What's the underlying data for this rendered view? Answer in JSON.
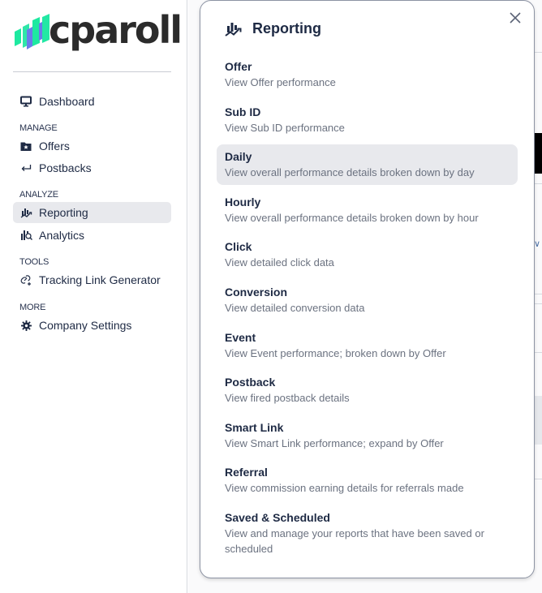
{
  "logo": {
    "text": "cparoll",
    "colors": {
      "stripe_green": "#1de9a0",
      "stripe_blue": "#6a7bea",
      "wordmark": "#2b2b2b"
    }
  },
  "sidebar": {
    "top_items": [
      {
        "label": "Dashboard",
        "icon": "monitor-icon"
      }
    ],
    "sections": [
      {
        "label": "MANAGE",
        "items": [
          {
            "label": "Offers",
            "icon": "folder-star-icon"
          },
          {
            "label": "Postbacks",
            "icon": "return-arrow-icon"
          }
        ]
      },
      {
        "label": "ANALYZE",
        "items": [
          {
            "label": "Reporting",
            "icon": "chart-trend-icon",
            "active": true
          },
          {
            "label": "Analytics",
            "icon": "chart-search-icon"
          }
        ]
      },
      {
        "label": "TOOLS",
        "items": [
          {
            "label": "Tracking Link Generator",
            "icon": "link-add-icon"
          }
        ]
      },
      {
        "label": "MORE",
        "items": [
          {
            "label": "Company Settings",
            "icon": "gear-icon"
          }
        ]
      }
    ]
  },
  "popover": {
    "title": "Reporting",
    "icon": "chart-trend-icon",
    "close_icon": "close-icon",
    "items": [
      {
        "title": "Offer",
        "description": "View Offer performance"
      },
      {
        "title": "Sub ID",
        "description": "View Sub ID performance"
      },
      {
        "title": "Daily",
        "description": "View overall performance details broken down by day",
        "hovered": true
      },
      {
        "title": "Hourly",
        "description": "View overall performance details broken down by hour"
      },
      {
        "title": "Click",
        "description": "View detailed click data"
      },
      {
        "title": "Conversion",
        "description": "View detailed conversion data"
      },
      {
        "title": "Event",
        "description": "View Event performance; broken down by Offer"
      },
      {
        "title": "Postback",
        "description": "View fired postback details"
      },
      {
        "title": "Smart Link",
        "description": "View Smart Link performance; expand by Offer"
      },
      {
        "title": "Referral",
        "description": "View commission earning details for referrals made"
      },
      {
        "title": "Saved & Scheduled",
        "description": "View and manage your reports that have been saved or scheduled"
      }
    ]
  },
  "colors": {
    "text_primary": "#1e2a44",
    "text_secondary": "#6b7280",
    "hover_bg": "#e8e9ed"
  }
}
